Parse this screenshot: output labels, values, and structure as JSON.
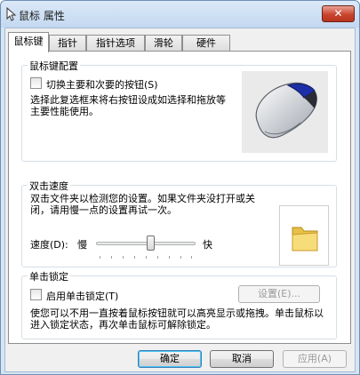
{
  "window": {
    "title": "鼠标 属性",
    "close_glyph": "✕"
  },
  "tabs": [
    {
      "label": "鼠标键",
      "active": true
    },
    {
      "label": "指针",
      "active": false
    },
    {
      "label": "指针选项",
      "active": false
    },
    {
      "label": "滑轮",
      "active": false
    },
    {
      "label": "硬件",
      "active": false
    }
  ],
  "button_config": {
    "title": "鼠标键配置",
    "switch_checkbox_label": "切换主要和次要的按钮(S)",
    "switch_checked": false,
    "description": "选择此复选框来将右按钮设成如选择和拖放等主要性能使用。"
  },
  "double_click": {
    "title": "双击速度",
    "description": "双击文件夹以检测您的设置。如果文件夹没打开或关闭，请用慢一点的设置再试一次。",
    "speed_label": "速度(D):",
    "slow_label": "慢",
    "fast_label": "快",
    "speed_fraction": 0.55
  },
  "click_lock": {
    "title": "单击锁定",
    "checkbox_label": "启用单击锁定(T)",
    "checked": false,
    "settings_button": "设置(E)...",
    "description": "使您可以不用一直按着鼠标按钮就可以高亮显示或拖拽。单击鼠标以进入锁定状态，再次单击鼠标可解除锁定。"
  },
  "footer": {
    "ok": "确定",
    "cancel": "取消",
    "apply": "应用(A)"
  },
  "colors": {
    "frame": "#d6e5f5",
    "close_button": "#c9452f",
    "default_button_focus": "#48c4f7",
    "disabled_text": "#9a9a9a"
  },
  "icons": {
    "title": "mouse-pointer-icon",
    "mouse": "mouse-icon",
    "folder": "folder-icon"
  }
}
